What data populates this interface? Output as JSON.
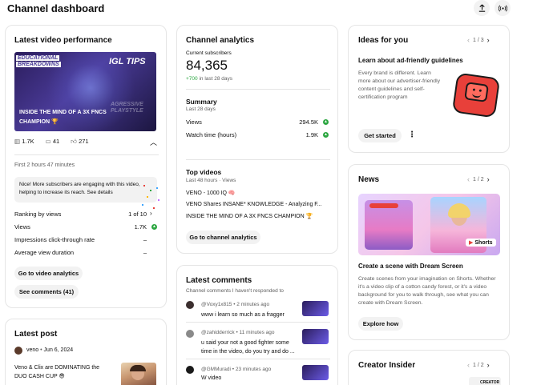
{
  "header": {
    "title": "Channel dashboard"
  },
  "latest_video": {
    "title": "Latest video performance",
    "thumb_tag1": "EDUCATIONAL",
    "thumb_tag2": "BREAKDOWNS",
    "thumb_brand": "IGL TIPS",
    "thumb_caption": "INSIDE THE MIND OF A 3X FNCS CHAMPION 🏆",
    "thumb_side": "AGRESSIVE PLAYSTYLE",
    "stats": {
      "views": "1.7K",
      "comments": "41",
      "likes": "271"
    },
    "first_period": "First 2 hours 47 minutes",
    "note": "Nice! More subscribers are engaging with this video, helping to increase its reach. See details",
    "rows": [
      {
        "label": "Ranking by views",
        "value": "1 of 10"
      },
      {
        "label": "Views",
        "value": "1.7K"
      },
      {
        "label": "Impressions click-through rate",
        "value": "–"
      },
      {
        "label": "Average view duration",
        "value": "–"
      }
    ],
    "btn_analytics": "Go to video analytics",
    "btn_comments": "See comments (41)"
  },
  "latest_post": {
    "title": "Latest post",
    "author": "veno",
    "date": "Jun 6, 2024",
    "text": "Veno & Clix are DOMINATING the DUO CASH CUP 😎"
  },
  "analytics": {
    "title": "Channel analytics",
    "subs_label": "Current subscribers",
    "subs_value": "84,365",
    "subs_change": "+700",
    "subs_change_suffix": "in last 28 days",
    "summary_title": "Summary",
    "summary_sub": "Last 28 days",
    "summary_rows": [
      {
        "label": "Views",
        "value": "294.5K"
      },
      {
        "label": "Watch time (hours)",
        "value": "1.9K"
      }
    ],
    "top_title": "Top videos",
    "top_sub": "Last 48 hours · Views",
    "top_videos": [
      "VENO - 1000 IQ 🧠",
      "VENO Shares INSANE* KNOWLEDGE - Analyzing F...",
      "INSIDE THE MIND OF A 3X FNCS CHAMPION 🏆"
    ],
    "btn": "Go to channel analytics"
  },
  "comments": {
    "title": "Latest comments",
    "sub": "Channel comments I haven't responded to",
    "items": [
      {
        "user": "@Voxy1x815",
        "time": "2 minutes ago",
        "text": "www i learn so much as a fragger",
        "avatar_color": "#3b2f2f"
      },
      {
        "user": "@zahidderrick",
        "time": "11 minutes ago",
        "text": "u said your not a good fighter some time in the video, do you try and do ...",
        "avatar_color": "#8a8a8a"
      },
      {
        "user": "@GMMuradi",
        "time": "23 minutes ago",
        "text": "W video",
        "avatar_color": "#1a1a1a"
      }
    ]
  },
  "ideas": {
    "title": "Ideas for you",
    "pager": "1 / 3",
    "headline": "Learn about ad-friendly guidelines",
    "body": "Every brand is different. Learn more about our advertiser-friendly content guidelines and self-certification program",
    "btn": "Get started",
    "more": "⋮"
  },
  "news": {
    "title": "News",
    "pager": "1 / 2",
    "shorts_label": "Shorts",
    "headline": "Create a scene with Dream Screen",
    "body": "Create scenes from your imagination on Shorts. Whether it's a video clip of a cotton candy forest, or it's a video background for you to walk through, see what you can create with Dream Screen.",
    "btn": "Explore how"
  },
  "insider": {
    "title": "Creator Insider",
    "pager": "1 / 2",
    "thumb_label": "CREATOR"
  },
  "colors": {
    "accent_green": "#2ba640",
    "chip": "#f2f2f2",
    "border": "#e5e5e5",
    "sticker_red": "#e8403a"
  }
}
